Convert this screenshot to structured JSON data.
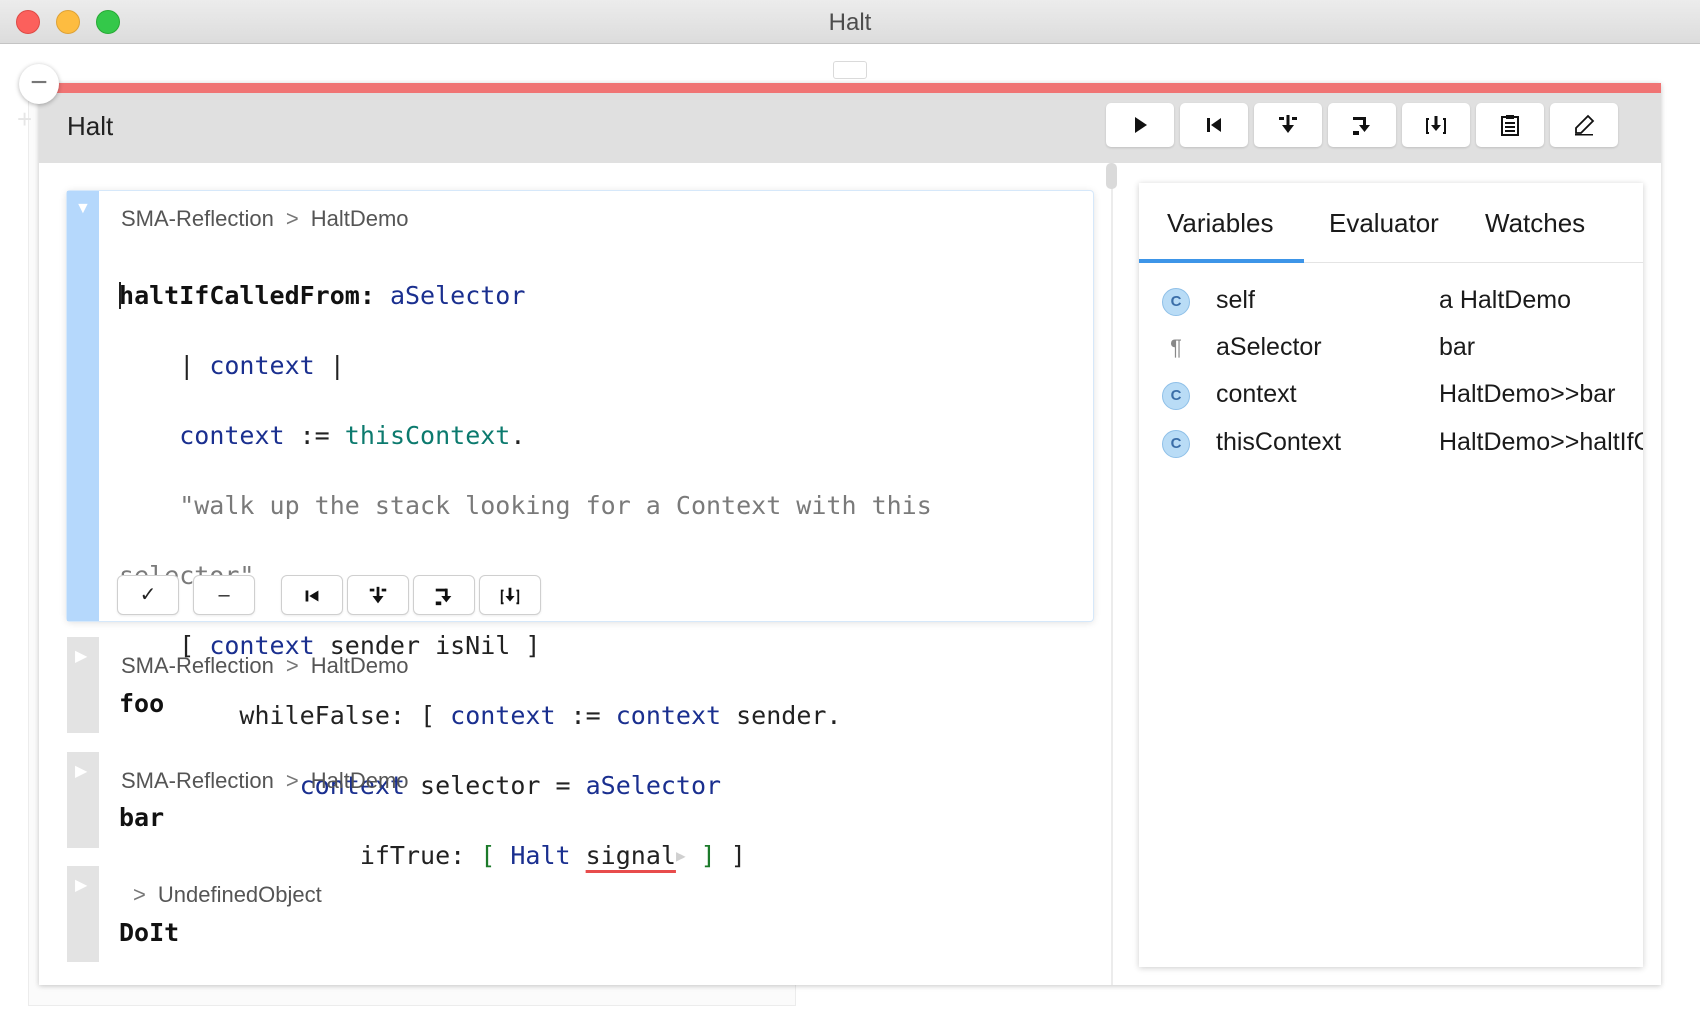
{
  "window": {
    "title": "Halt"
  },
  "debugger": {
    "title": "Halt",
    "toolbar": [
      {
        "name": "resume-button",
        "icon": "play-icon"
      },
      {
        "name": "restart-button",
        "icon": "restart-icon"
      },
      {
        "name": "step-into-button",
        "icon": "step-into-icon"
      },
      {
        "name": "step-over-button",
        "icon": "step-over-icon"
      },
      {
        "name": "step-through-button",
        "icon": "step-through-icon"
      },
      {
        "name": "copy-stack-button",
        "icon": "clipboard-icon"
      },
      {
        "name": "edit-button",
        "icon": "pencil-icon"
      }
    ],
    "selected_frame": {
      "package": "SMA-Reflection",
      "separator": ">",
      "class": "HaltDemo",
      "method": "haltIfCalledFrom:",
      "code": {
        "l1_selector": "altIfCalledFrom:",
        "l1_first_char": "h",
        "l1_arg": "aSelector",
        "l2_indent": "    | ",
        "l2_temp": "context",
        "l2_end": " |",
        "l3_indent": "    ",
        "l3_var": "context",
        "l3_op": " := ",
        "l3_tc": "thisContext",
        "l3_end": ".",
        "l4_comment": "    \"walk up the stack looking for a Context with this",
        "l5_comment": "selector\"",
        "l6_open": "    [ ",
        "l6_var": "context",
        "l6_rest": " sender isNil ]",
        "l7_indent": "        whileFalse: [ ",
        "l7_var1": "context",
        "l7_op": " := ",
        "l7_var2": "context",
        "l7_rest": " sender.",
        "l8_indent": "            ",
        "l8_var": "context",
        "l8_mid": " selector = ",
        "l8_arg": "aSelector",
        "l9_indent": "                ifTrue: ",
        "l9_open": "[ ",
        "l9_halt": "Halt",
        "l9_sp": " ",
        "l9_signal": "signal",
        "l9_marker": "▶",
        "l9_close": " ]",
        "l9_end": " ]"
      },
      "actions": [
        {
          "name": "accept-button",
          "label": "✓"
        },
        {
          "name": "cancel-button",
          "label": "–"
        },
        {
          "name": "frame-restart-button",
          "icon": "restart-icon"
        },
        {
          "name": "frame-step-into-button",
          "icon": "step-into-icon"
        },
        {
          "name": "frame-step-over-button",
          "icon": "step-over-icon"
        },
        {
          "name": "frame-step-through-button",
          "icon": "step-through-icon"
        }
      ]
    },
    "frames": [
      {
        "package": "SMA-Reflection",
        "separator": ">",
        "class": "HaltDemo",
        "method": "foo"
      },
      {
        "package": "SMA-Reflection",
        "separator": ">",
        "class": "HaltDemo",
        "method": "bar"
      },
      {
        "package": "",
        "separator": ">",
        "class": "UndefinedObject",
        "method": "DoIt"
      }
    ]
  },
  "inspector": {
    "tabs": [
      "Variables",
      "Evaluator",
      "Watches"
    ],
    "active_tab": "Variables",
    "variables": [
      {
        "icon": "c-icon",
        "glyph": "C",
        "name": "self",
        "value": "a HaltDemo"
      },
      {
        "icon": "pilcrow-icon",
        "glyph": "¶",
        "name": "aSelector",
        "value": "bar"
      },
      {
        "icon": "c-icon",
        "glyph": "C",
        "name": "context",
        "value": "HaltDemo>>bar"
      },
      {
        "icon": "c-icon",
        "glyph": "C",
        "name": "thisContext",
        "value": "HaltDemo>>haltIfCalledFrom:"
      }
    ]
  },
  "colors": {
    "halt_bar": "#f07474",
    "selection_gutter": "#b5d8fc",
    "tab_accent": "#3d95e8"
  }
}
